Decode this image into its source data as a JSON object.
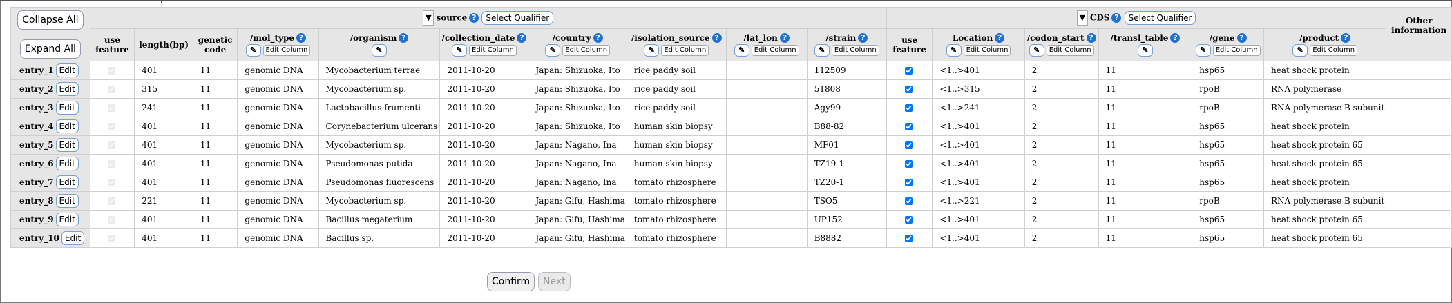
{
  "controls": {
    "collapse_all": "Collapse All",
    "expand_all": "Expand All",
    "select_qualifier": "Select Qualifier",
    "edit_column": "Edit Column",
    "edit": "Edit",
    "confirm": "Confirm",
    "next": "Next"
  },
  "groups": {
    "source": "source",
    "cds": "CDS",
    "other": "Other information"
  },
  "headers": {
    "use_feature": "use feature",
    "length": "length(bp)",
    "genetic_code": "genetic code",
    "mol_type": "/mol_type",
    "organism": "/organism",
    "collection_date": "/collection_date",
    "country": "/country",
    "isolation_source": "/isolation_source",
    "lat_lon": "/lat_lon",
    "strain": "/strain",
    "cds_use_feature": "use feature",
    "location": "Location",
    "codon_start": "/codon_start",
    "transl_table": "/transl_table",
    "gene": "/gene",
    "product": "/product"
  },
  "icons": {
    "help": "help-icon",
    "expand_triangle": "triangle-down-icon",
    "pencil": "pencil-icon"
  },
  "entries": [
    {
      "name": "entry_1",
      "length": "401",
      "code": "11",
      "mol_type": "genomic DNA",
      "organism": "Mycobacterium terrae",
      "date": "2011-10-20",
      "country": "Japan: Shizuoka, Ito",
      "isolation": "rice paddy soil",
      "lat_lon": "",
      "strain": "112509",
      "location": "<1..>401",
      "codon": "2",
      "transl": "11",
      "gene": "hsp65",
      "product": "heat shock protein"
    },
    {
      "name": "entry_2",
      "length": "315",
      "code": "11",
      "mol_type": "genomic DNA",
      "organism": "Mycobacterium sp.",
      "date": "2011-10-20",
      "country": "Japan: Shizuoka, Ito",
      "isolation": "rice paddy soil",
      "lat_lon": "",
      "strain": "51808",
      "location": "<1..>315",
      "codon": "2",
      "transl": "11",
      "gene": "rpoB",
      "product": "RNA polymerase"
    },
    {
      "name": "entry_3",
      "length": "241",
      "code": "11",
      "mol_type": "genomic DNA",
      "organism": "Lactobacillus frumenti",
      "date": "2011-10-20",
      "country": "Japan: Shizuoka, Ito",
      "isolation": "rice paddy soil",
      "lat_lon": "",
      "strain": "Agy99",
      "location": "<1..>241",
      "codon": "2",
      "transl": "11",
      "gene": "rpoB",
      "product": "RNA polymerase B subunit"
    },
    {
      "name": "entry_4",
      "length": "401",
      "code": "11",
      "mol_type": "genomic DNA",
      "organism": "Corynebacterium ulcerans",
      "date": "2011-10-20",
      "country": "Japan: Shizuoka, Ito",
      "isolation": "human skin biopsy",
      "lat_lon": "",
      "strain": "B88-82",
      "location": "<1..>401",
      "codon": "2",
      "transl": "11",
      "gene": "hsp65",
      "product": "heat shock protein"
    },
    {
      "name": "entry_5",
      "length": "401",
      "code": "11",
      "mol_type": "genomic DNA",
      "organism": "Mycobacterium sp.",
      "date": "2011-10-20",
      "country": "Japan: Nagano, Ina",
      "isolation": "human skin biopsy",
      "lat_lon": "",
      "strain": "MF01",
      "location": "<1..>401",
      "codon": "2",
      "transl": "11",
      "gene": "hsp65",
      "product": "heat shock protein 65"
    },
    {
      "name": "entry_6",
      "length": "401",
      "code": "11",
      "mol_type": "genomic DNA",
      "organism": "Pseudomonas putida",
      "date": "2011-10-20",
      "country": "Japan: Nagano, Ina",
      "isolation": "human skin biopsy",
      "lat_lon": "",
      "strain": "TZ19-1",
      "location": "<1..>401",
      "codon": "2",
      "transl": "11",
      "gene": "hsp65",
      "product": "heat shock protein 65"
    },
    {
      "name": "entry_7",
      "length": "401",
      "code": "11",
      "mol_type": "genomic DNA",
      "organism": "Pseudomonas fluorescens",
      "date": "2011-10-20",
      "country": "Japan: Nagano, Ina",
      "isolation": "tomato rhizosphere",
      "lat_lon": "",
      "strain": "TZ20-1",
      "location": "<1..>401",
      "codon": "2",
      "transl": "11",
      "gene": "hsp65",
      "product": "heat shock protein"
    },
    {
      "name": "entry_8",
      "length": "221",
      "code": "11",
      "mol_type": "genomic DNA",
      "organism": "Mycobacterium sp.",
      "date": "2011-10-20",
      "country": "Japan: Gifu, Hashima",
      "isolation": "tomato rhizosphere",
      "lat_lon": "",
      "strain": "TSO5",
      "location": "<1..>221",
      "codon": "2",
      "transl": "11",
      "gene": "rpoB",
      "product": "RNA polymerase B subunit"
    },
    {
      "name": "entry_9",
      "length": "401",
      "code": "11",
      "mol_type": "genomic DNA",
      "organism": "Bacillus megaterium",
      "date": "2011-10-20",
      "country": "Japan: Gifu, Hashima",
      "isolation": "tomato rhizosphere",
      "lat_lon": "",
      "strain": "UP152",
      "location": "<1..>401",
      "codon": "2",
      "transl": "11",
      "gene": "hsp65",
      "product": "heat shock protein 65"
    },
    {
      "name": "entry_10",
      "length": "401",
      "code": "11",
      "mol_type": "genomic DNA",
      "organism": "Bacillus sp.",
      "date": "2011-10-20",
      "country": "Japan: Gifu, Hashima",
      "isolation": "tomato rhizosphere",
      "lat_lon": "",
      "strain": "B8882",
      "location": "<1..>401",
      "codon": "2",
      "transl": "11",
      "gene": "hsp65",
      "product": "heat shock protein 65"
    }
  ]
}
